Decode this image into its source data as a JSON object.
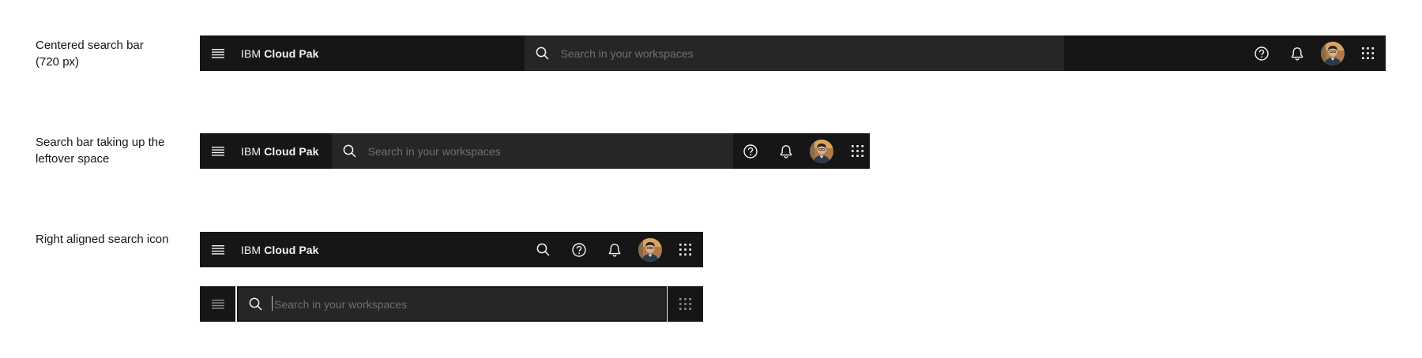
{
  "rows": {
    "centered": {
      "label_line1": "Centered search bar",
      "label_line2": "(720 px)"
    },
    "leftover": {
      "label_line1": "Search bar taking up the",
      "label_line2": "leftover space"
    },
    "right_aligned": {
      "label": "Right aligned search icon"
    }
  },
  "brand": {
    "prefix": "IBM",
    "product": "Cloud Pak"
  },
  "search": {
    "placeholder": "Search in your workspaces"
  },
  "icons": {
    "menu": "hamburger-menu-icon",
    "search": "search-icon",
    "help": "help-icon",
    "notifications": "notification-bell-icon",
    "avatar": "user-avatar",
    "switcher": "app-switcher-icon"
  },
  "colors": {
    "header_bg": "#161616",
    "search_bg": "#262626",
    "text": "#f4f4f4",
    "placeholder": "#6f6f6f",
    "label": "#161616"
  }
}
